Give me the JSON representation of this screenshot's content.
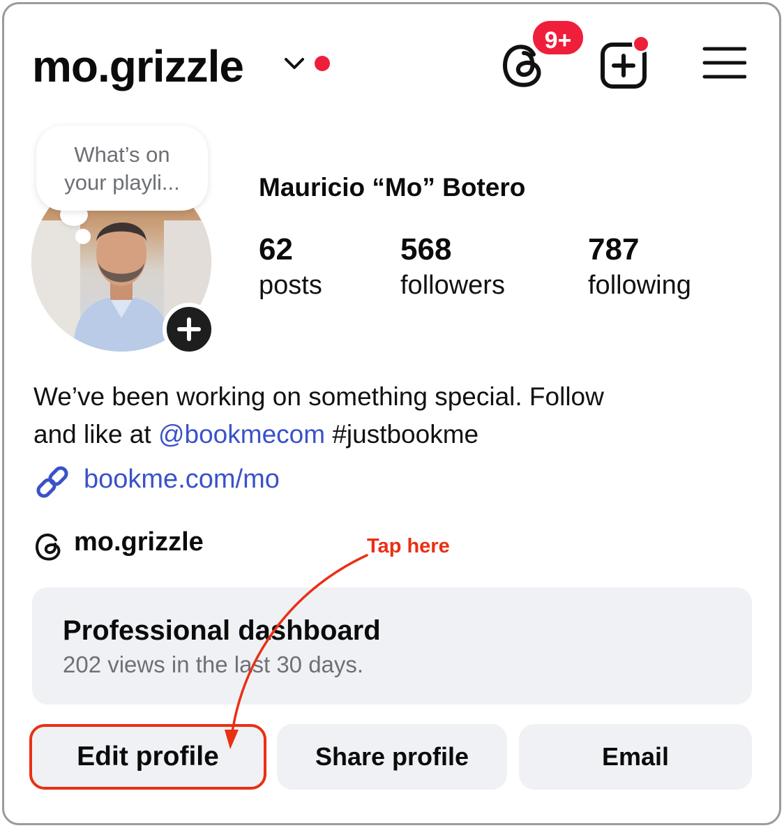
{
  "header": {
    "username": "mo.grizzle",
    "notification_badge": "9+"
  },
  "profile": {
    "note_text": "What’s on your playli...",
    "full_name": "Mauricio “Mo” Botero",
    "stats": [
      {
        "value": "62",
        "label": "posts"
      },
      {
        "value": "568",
        "label": "followers"
      },
      {
        "value": "787",
        "label": "following"
      }
    ],
    "bio": {
      "line1": "We’ve been working on something special. Follow",
      "line2_prefix": "and like at ",
      "mention": "@bookmecom",
      "hashtag": " #justbookme"
    },
    "link": "bookme.com/mo",
    "threads_handle": "mo.grizzle"
  },
  "dashboard": {
    "title": "Professional dashboard",
    "subtitle": "202 views in the last 30 days."
  },
  "buttons": {
    "edit": "Edit profile",
    "share": "Share profile",
    "email": "Email"
  },
  "annotation": {
    "label": "Tap here"
  },
  "colors": {
    "accent_red": "#ef1e3a",
    "link_blue": "#3a52c9",
    "annotation_red": "#ea2f13",
    "button_bg": "#eff1f4"
  },
  "icons": [
    "chevron-down-icon",
    "threads-icon",
    "new-post-icon",
    "menu-icon",
    "add-story-icon",
    "link-icon"
  ]
}
